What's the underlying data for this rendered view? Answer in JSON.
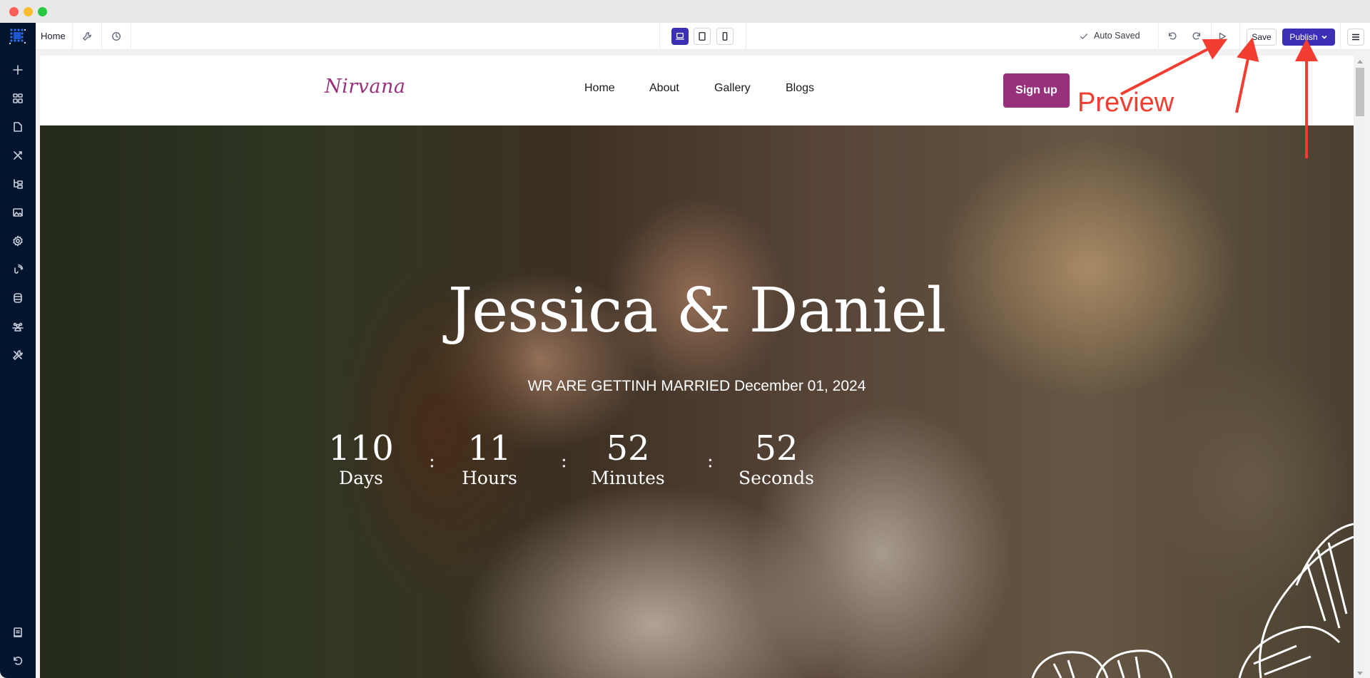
{
  "window": {
    "controls": [
      "close",
      "minimize",
      "maximize"
    ]
  },
  "toolbar": {
    "page_name": "Home",
    "settings_icon": "wrench-icon",
    "history_icon": "clock-icon",
    "devices": [
      {
        "name": "desktop",
        "icon": "laptop-icon",
        "active": true
      },
      {
        "name": "tablet",
        "icon": "tablet-icon",
        "active": false
      },
      {
        "name": "mobile",
        "icon": "phone-icon",
        "active": false
      }
    ],
    "status": "Auto Saved",
    "undo_icon": "undo-icon",
    "redo_icon": "redo-icon",
    "preview_icon": "play-icon",
    "save_label": "Save",
    "publish_label": "Publish",
    "menu_icon": "hamburger-icon",
    "accent_color": "#3a2fb5"
  },
  "sidebar": {
    "logo": "grid-logo-icon",
    "items": [
      {
        "name": "add",
        "icon": "plus-icon"
      },
      {
        "name": "sections",
        "icon": "blocks-icon"
      },
      {
        "name": "pages",
        "icon": "page-icon"
      },
      {
        "name": "design",
        "icon": "pen-ruler-icon"
      },
      {
        "name": "structure",
        "icon": "tree-icon"
      },
      {
        "name": "media",
        "icon": "image-icon"
      },
      {
        "name": "settings",
        "icon": "gear-icon"
      },
      {
        "name": "integrations",
        "icon": "signal-icon"
      },
      {
        "name": "database",
        "icon": "database-icon"
      },
      {
        "name": "members",
        "icon": "users-icon"
      },
      {
        "name": "tools",
        "icon": "tools-icon"
      }
    ],
    "bottom_items": [
      {
        "name": "docs",
        "icon": "book-icon"
      },
      {
        "name": "history",
        "icon": "restore-icon"
      }
    ]
  },
  "site": {
    "brand": "Nirvana",
    "brand_color": "#98307c",
    "nav": [
      "Home",
      "About",
      "Gallery",
      "Blogs"
    ],
    "cta": "Sign up",
    "hero": {
      "title": "Jessica & Daniel",
      "subtitle": "WR ARE GETTINH MARRIED December 01, 2024",
      "countdown": [
        {
          "value": "110",
          "label": "Days"
        },
        {
          "value": "11",
          "label": "Hours"
        },
        {
          "value": "52",
          "label": "Minutes"
        },
        {
          "value": "52",
          "label": "Seconds"
        }
      ],
      "separator": ":"
    }
  },
  "annotation": {
    "label": "Preview",
    "color": "#f23d30"
  }
}
